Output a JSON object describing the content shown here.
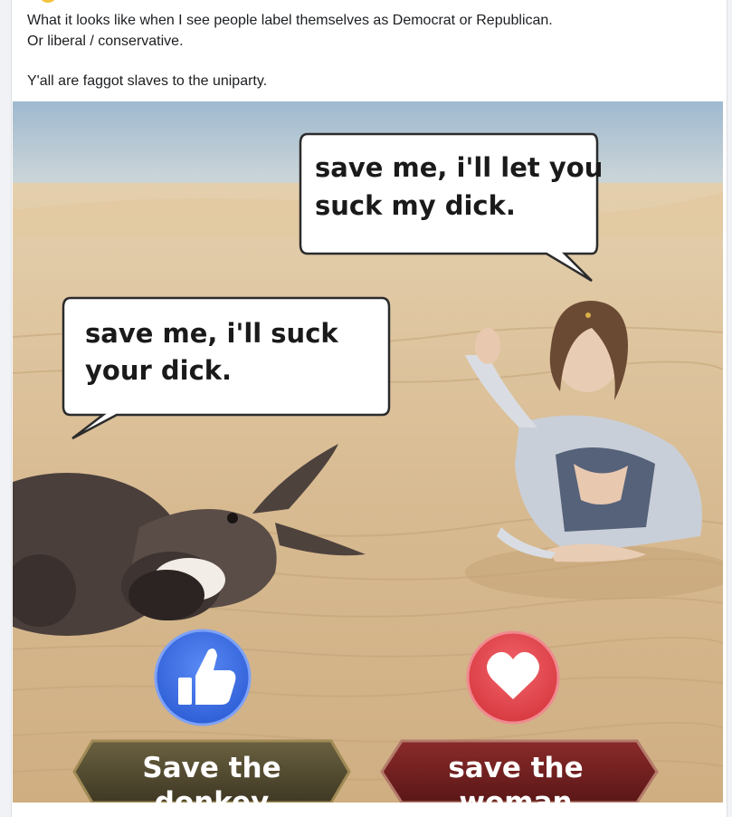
{
  "post": {
    "line1": "What it looks like when I see people label themselves as Democrat or Republican.",
    "line2": "Or liberal / conservative.",
    "line3": "Y'all are faggot slaves to the uniparty."
  },
  "meme": {
    "bubble_right": {
      "line1": "save me, i'll let you",
      "line2": "suck my dick."
    },
    "bubble_left": {
      "line1": "save me, i'll suck",
      "line2": "your dick."
    },
    "left_reaction": {
      "icon": "thumbs-up-icon",
      "color": "#3b6ee8",
      "label_line1": "Save the",
      "label_line2": "donkey"
    },
    "right_reaction": {
      "icon": "heart-icon",
      "color": "#e8474e",
      "label_line1": "save the",
      "label_line2": "woman"
    }
  }
}
